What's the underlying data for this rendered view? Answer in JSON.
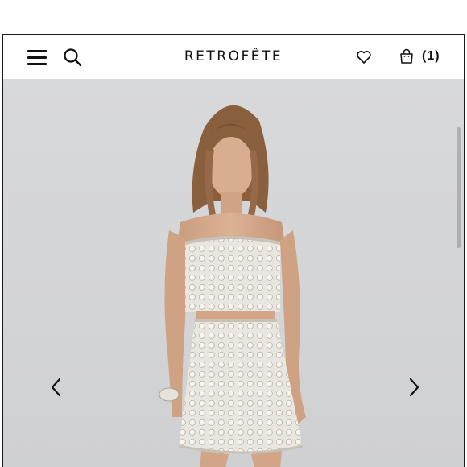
{
  "header": {
    "brand": "RETROFÊTE",
    "cart_count": "(1)"
  },
  "icons": {
    "menu": "hamburger-menu-icon",
    "search": "search-icon",
    "wishlist": "heart-icon",
    "cart": "shopping-bag-icon",
    "prev": "chevron-left-icon",
    "next": "chevron-right-icon"
  },
  "colors": {
    "background": "#ffffff",
    "text": "#111111",
    "hero_bg": "#d4d5d7"
  }
}
